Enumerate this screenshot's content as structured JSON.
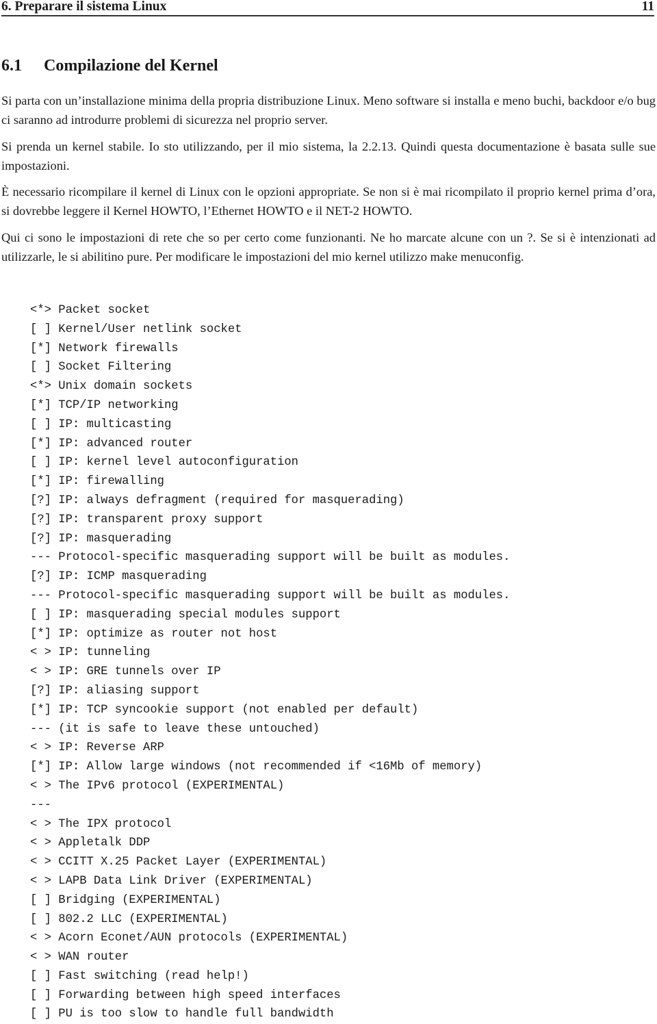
{
  "header": {
    "chapter": "6.  Preparare il sistema Linux",
    "page_number": "11"
  },
  "section": {
    "number": "6.1",
    "title": "Compilazione del Kernel"
  },
  "paragraphs": [
    "Si parta con un’installazione minima della propria distribuzione Linux.  Meno software si installa e meno buchi, backdoor e/o bug ci saranno ad introdurre problemi di sicurezza nel proprio server.",
    "Si prenda un kernel stabile. Io sto utilizzando, per il mio sistema, la 2.2.13. Quindi questa documentazione è basata sulle sue impostazioni.",
    "È necessario ricompilare il kernel di Linux con le opzioni appropriate. Se non si è mai ricompilato il proprio kernel prima d’ora, si dovrebbe leggere il Kernel HOWTO, l’Ethernet HOWTO e il NET-2 HOWTO.",
    "Qui ci sono le impostazioni di rete che so per certo come funzionanti. Ne ho marcate alcune con un ?. Se si è intenzionati ad utilizzarle, le si abilitino pure. Per modificare le impostazioni del mio kernel utilizzo make menuconfig."
  ],
  "config_lines": [
    {
      "marker": "<*>",
      "text": "Packet socket"
    },
    {
      "marker": "[ ]",
      "text": "Kernel/User netlink socket"
    },
    {
      "marker": "[*]",
      "text": "Network firewalls"
    },
    {
      "marker": "[ ]",
      "text": "Socket Filtering"
    },
    {
      "marker": "<*>",
      "text": "Unix domain sockets"
    },
    {
      "marker": "[*]",
      "text": "TCP/IP networking"
    },
    {
      "marker": "[ ]",
      "text": "IP: multicasting"
    },
    {
      "marker": "[*]",
      "text": "IP: advanced router"
    },
    {
      "marker": "[ ]",
      "text": "IP: kernel level autoconfiguration"
    },
    {
      "marker": "[*]",
      "text": "IP: firewalling"
    },
    {
      "marker": "[?]",
      "text": "IP: always defragment (required for masquerading)"
    },
    {
      "marker": "[?]",
      "text": "IP: transparent proxy support"
    },
    {
      "marker": "[?]",
      "text": "IP: masquerading"
    },
    {
      "marker": "---",
      "text": "Protocol-specific masquerading support will be built as modules."
    },
    {
      "marker": "[?]",
      "text": "IP: ICMP masquerading"
    },
    {
      "marker": "---",
      "text": "Protocol-specific masquerading support will be built as modules."
    },
    {
      "marker": "[ ]",
      "text": "IP: masquerading special modules support"
    },
    {
      "marker": "[*]",
      "text": "IP: optimize as router not host"
    },
    {
      "marker": "< >",
      "text": "IP: tunneling"
    },
    {
      "marker": "< >",
      "text": "IP: GRE tunnels over IP"
    },
    {
      "marker": "[?]",
      "text": "IP: aliasing support"
    },
    {
      "marker": "[*]",
      "text": "IP: TCP syncookie support (not enabled per default)"
    },
    {
      "marker": "---",
      "text": "(it is safe to leave these untouched)"
    },
    {
      "marker": "< >",
      "text": "IP: Reverse ARP"
    },
    {
      "marker": "[*]",
      "text": "IP: Allow large windows (not recommended if <16Mb of memory)"
    },
    {
      "marker": "< >",
      "text": "The IPv6 protocol (EXPERIMENTAL)"
    },
    {
      "marker": "---",
      "text": ""
    },
    {
      "marker": "< >",
      "text": "The IPX protocol"
    },
    {
      "marker": "< >",
      "text": "Appletalk DDP"
    },
    {
      "marker": "< >",
      "text": "CCITT X.25 Packet Layer (EXPERIMENTAL)"
    },
    {
      "marker": "< >",
      "text": "LAPB Data Link Driver (EXPERIMENTAL)"
    },
    {
      "marker": "[ ]",
      "text": "Bridging (EXPERIMENTAL)"
    },
    {
      "marker": "[ ]",
      "text": "802.2 LLC (EXPERIMENTAL)"
    },
    {
      "marker": "< >",
      "text": "Acorn Econet/AUN protocols (EXPERIMENTAL)"
    },
    {
      "marker": "< >",
      "text": "WAN router"
    },
    {
      "marker": "[ ]",
      "text": "Fast switching (read help!)"
    },
    {
      "marker": "[ ]",
      "text": "Forwarding between high speed interfaces"
    },
    {
      "marker": "[ ]",
      "text": "PU is too slow to handle full bandwidth"
    }
  ]
}
